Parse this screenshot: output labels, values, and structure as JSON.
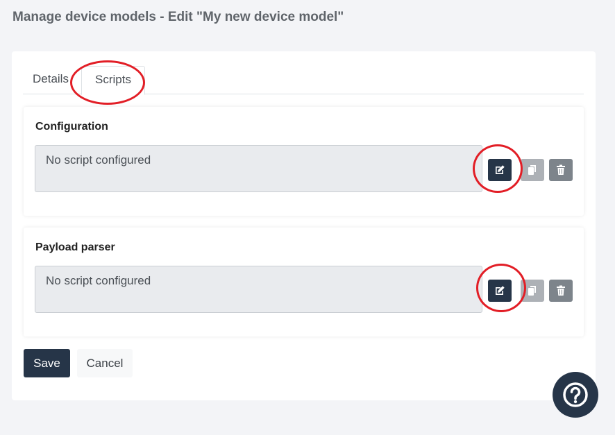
{
  "page": {
    "title": "Manage device models - Edit \"My new device model\""
  },
  "tabs": [
    {
      "label": "Details",
      "active": false
    },
    {
      "label": "Scripts",
      "active": true
    }
  ],
  "sections": [
    {
      "title": "Configuration",
      "script_status": "No script configured"
    },
    {
      "title": "Payload parser",
      "script_status": "No script configured"
    }
  ],
  "actions": {
    "save_label": "Save",
    "cancel_label": "Cancel"
  },
  "icons": {
    "edit": "edit-icon",
    "copy": "copy-icon",
    "delete": "trash-icon",
    "help": "help-icon"
  },
  "colors": {
    "primary": "#263548",
    "annotation": "#e21e26",
    "script_box_bg": "#e9ebee",
    "copy_button": "#adb1b6",
    "delete_button": "#7d848b"
  }
}
